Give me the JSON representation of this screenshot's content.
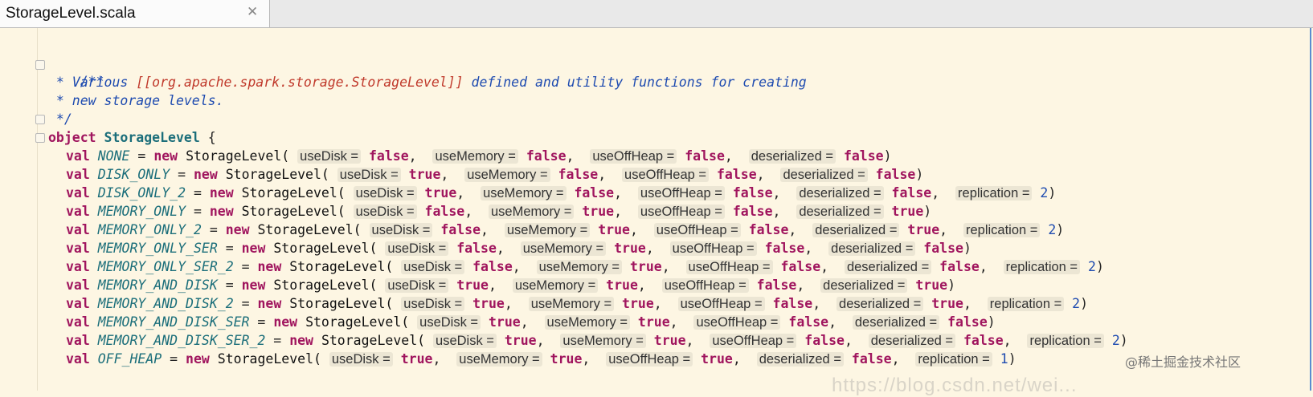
{
  "tab": {
    "title": "StorageLevel.scala",
    "close_symbol": "✕"
  },
  "code": {
    "doc": [
      "/**",
      " * Various ",
      "[[org.apache.spark.storage.StorageLevel]]",
      " defined and utility functions for creating",
      " * new storage levels.",
      " */"
    ],
    "object_kw": "object",
    "object_name": "StorageLevel",
    "open_brace": " {",
    "val_kw": "val",
    "new_kw": "new",
    "type": "StorageLevel(",
    "labels": {
      "useDisk": "useDisk =",
      "useMemory": "useMemory =",
      "useOffHeap": "useOffHeap =",
      "deserialized": "deserialized =",
      "replication": "replication ="
    },
    "levels": [
      {
        "name": "NONE",
        "disk": "false",
        "memory": "false",
        "offheap": "false",
        "deser": "false",
        "rep": ""
      },
      {
        "name": "DISK_ONLY",
        "disk": "true",
        "memory": "false",
        "offheap": "false",
        "deser": "false",
        "rep": ""
      },
      {
        "name": "DISK_ONLY_2",
        "disk": "true",
        "memory": "false",
        "offheap": "false",
        "deser": "false",
        "rep": "2"
      },
      {
        "name": "MEMORY_ONLY",
        "disk": "false",
        "memory": "true",
        "offheap": "false",
        "deser": "true",
        "rep": ""
      },
      {
        "name": "MEMORY_ONLY_2",
        "disk": "false",
        "memory": "true",
        "offheap": "false",
        "deser": "true",
        "rep": "2"
      },
      {
        "name": "MEMORY_ONLY_SER",
        "disk": "false",
        "memory": "true",
        "offheap": "false",
        "deser": "false",
        "rep": ""
      },
      {
        "name": "MEMORY_ONLY_SER_2",
        "disk": "false",
        "memory": "true",
        "offheap": "false",
        "deser": "false",
        "rep": "2"
      },
      {
        "name": "MEMORY_AND_DISK",
        "disk": "true",
        "memory": "true",
        "offheap": "false",
        "deser": "true",
        "rep": ""
      },
      {
        "name": "MEMORY_AND_DISK_2",
        "disk": "true",
        "memory": "true",
        "offheap": "false",
        "deser": "true",
        "rep": "2"
      },
      {
        "name": "MEMORY_AND_DISK_SER",
        "disk": "true",
        "memory": "true",
        "offheap": "false",
        "deser": "false",
        "rep": ""
      },
      {
        "name": "MEMORY_AND_DISK_SER_2",
        "disk": "true",
        "memory": "true",
        "offheap": "false",
        "deser": "false",
        "rep": "2"
      },
      {
        "name": "OFF_HEAP",
        "disk": "true",
        "memory": "true",
        "offheap": "true",
        "deser": "false",
        "rep": "1"
      }
    ]
  },
  "watermark": "@稀土掘金技术社区",
  "faint_watermark": "https://blog.csdn.net/wei..."
}
